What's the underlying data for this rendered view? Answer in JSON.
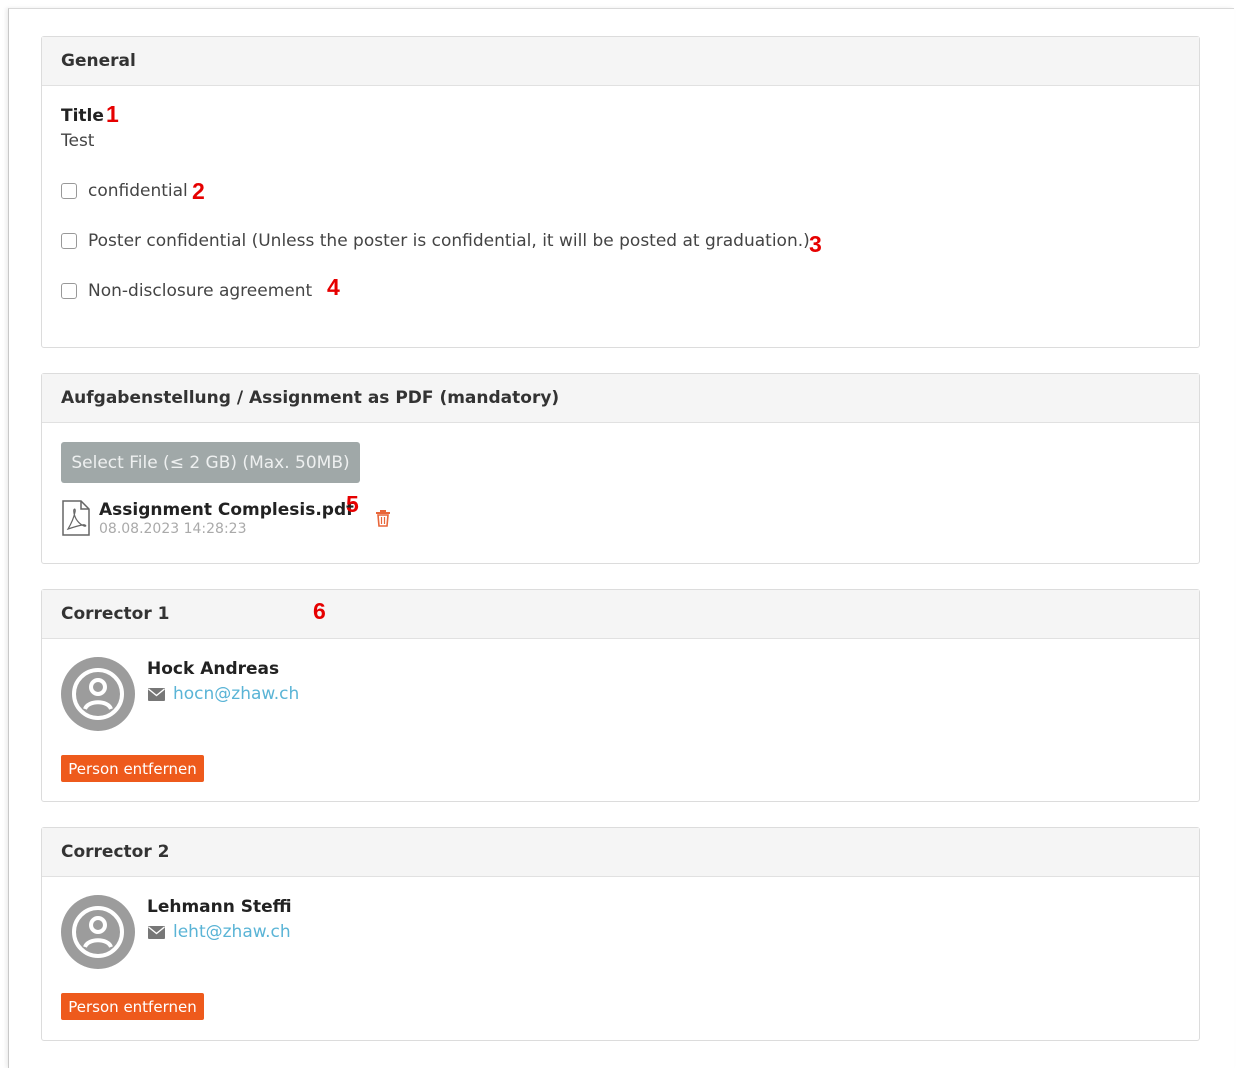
{
  "general": {
    "heading": "General",
    "title_label": "Title",
    "title_value": "Test",
    "checkboxes": [
      {
        "label": "confidential",
        "checked": false
      },
      {
        "label": "Poster confidential (Unless the poster is confidential, it will be posted at graduation.)",
        "checked": false
      },
      {
        "label": "Non-disclosure agreement",
        "checked": false
      }
    ]
  },
  "assignment": {
    "heading": "Aufgabenstellung / Assignment as PDF (mandatory)",
    "select_button_label": "Select File (≤ 2 GB) (Max. 50MB)",
    "file": {
      "name": "Assignment Complesis.pdf",
      "date": "08.08.2023 14:28:23",
      "icon": "pdf-file-icon"
    },
    "delete_icon": "trash-icon"
  },
  "correctors": [
    {
      "heading": "Corrector 1",
      "name": "Hock Andreas",
      "email": "hocn@zhaw.ch",
      "remove_label": "Person entfernen"
    },
    {
      "heading": "Corrector 2",
      "name": "Lehmann Steffi",
      "email": "leht@zhaw.ch",
      "remove_label": "Person entfernen"
    }
  ],
  "annotations": [
    "1",
    "2",
    "3",
    "4",
    "5",
    "6"
  ],
  "colors": {
    "annotation": "#e60000",
    "remove_button": "#ee5a1c",
    "select_button": "#a0a8a8",
    "link": "#5ab4d6",
    "trash": "#e8663a"
  }
}
